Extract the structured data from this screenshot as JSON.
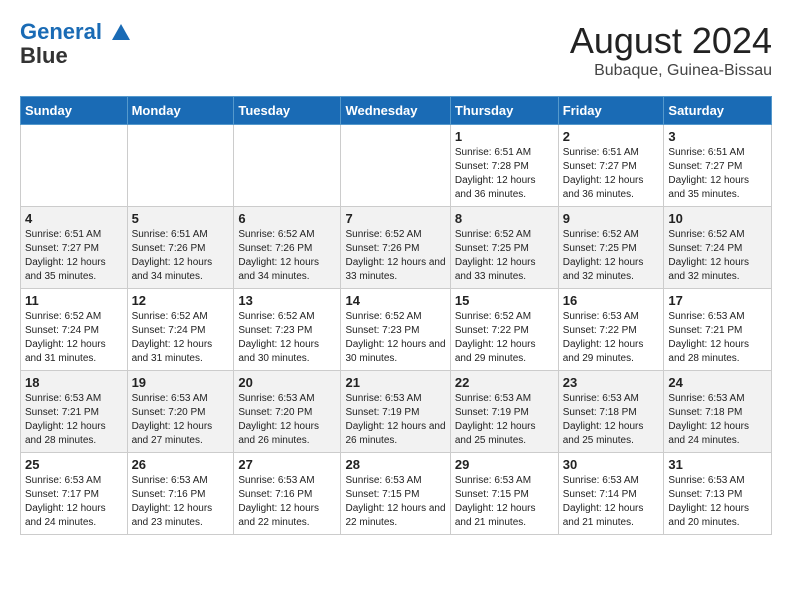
{
  "header": {
    "logo_line1": "General",
    "logo_line2": "Blue",
    "month_year": "August 2024",
    "location": "Bubaque, Guinea-Bissau"
  },
  "weekdays": [
    "Sunday",
    "Monday",
    "Tuesday",
    "Wednesday",
    "Thursday",
    "Friday",
    "Saturday"
  ],
  "weeks": [
    [
      {
        "day": "",
        "sunrise": "",
        "sunset": "",
        "daylight": ""
      },
      {
        "day": "",
        "sunrise": "",
        "sunset": "",
        "daylight": ""
      },
      {
        "day": "",
        "sunrise": "",
        "sunset": "",
        "daylight": ""
      },
      {
        "day": "",
        "sunrise": "",
        "sunset": "",
        "daylight": ""
      },
      {
        "day": "1",
        "sunrise": "Sunrise: 6:51 AM",
        "sunset": "Sunset: 7:28 PM",
        "daylight": "Daylight: 12 hours and 36 minutes."
      },
      {
        "day": "2",
        "sunrise": "Sunrise: 6:51 AM",
        "sunset": "Sunset: 7:27 PM",
        "daylight": "Daylight: 12 hours and 36 minutes."
      },
      {
        "day": "3",
        "sunrise": "Sunrise: 6:51 AM",
        "sunset": "Sunset: 7:27 PM",
        "daylight": "Daylight: 12 hours and 35 minutes."
      }
    ],
    [
      {
        "day": "4",
        "sunrise": "Sunrise: 6:51 AM",
        "sunset": "Sunset: 7:27 PM",
        "daylight": "Daylight: 12 hours and 35 minutes."
      },
      {
        "day": "5",
        "sunrise": "Sunrise: 6:51 AM",
        "sunset": "Sunset: 7:26 PM",
        "daylight": "Daylight: 12 hours and 34 minutes."
      },
      {
        "day": "6",
        "sunrise": "Sunrise: 6:52 AM",
        "sunset": "Sunset: 7:26 PM",
        "daylight": "Daylight: 12 hours and 34 minutes."
      },
      {
        "day": "7",
        "sunrise": "Sunrise: 6:52 AM",
        "sunset": "Sunset: 7:26 PM",
        "daylight": "Daylight: 12 hours and 33 minutes."
      },
      {
        "day": "8",
        "sunrise": "Sunrise: 6:52 AM",
        "sunset": "Sunset: 7:25 PM",
        "daylight": "Daylight: 12 hours and 33 minutes."
      },
      {
        "day": "9",
        "sunrise": "Sunrise: 6:52 AM",
        "sunset": "Sunset: 7:25 PM",
        "daylight": "Daylight: 12 hours and 32 minutes."
      },
      {
        "day": "10",
        "sunrise": "Sunrise: 6:52 AM",
        "sunset": "Sunset: 7:24 PM",
        "daylight": "Daylight: 12 hours and 32 minutes."
      }
    ],
    [
      {
        "day": "11",
        "sunrise": "Sunrise: 6:52 AM",
        "sunset": "Sunset: 7:24 PM",
        "daylight": "Daylight: 12 hours and 31 minutes."
      },
      {
        "day": "12",
        "sunrise": "Sunrise: 6:52 AM",
        "sunset": "Sunset: 7:24 PM",
        "daylight": "Daylight: 12 hours and 31 minutes."
      },
      {
        "day": "13",
        "sunrise": "Sunrise: 6:52 AM",
        "sunset": "Sunset: 7:23 PM",
        "daylight": "Daylight: 12 hours and 30 minutes."
      },
      {
        "day": "14",
        "sunrise": "Sunrise: 6:52 AM",
        "sunset": "Sunset: 7:23 PM",
        "daylight": "Daylight: 12 hours and 30 minutes."
      },
      {
        "day": "15",
        "sunrise": "Sunrise: 6:52 AM",
        "sunset": "Sunset: 7:22 PM",
        "daylight": "Daylight: 12 hours and 29 minutes."
      },
      {
        "day": "16",
        "sunrise": "Sunrise: 6:53 AM",
        "sunset": "Sunset: 7:22 PM",
        "daylight": "Daylight: 12 hours and 29 minutes."
      },
      {
        "day": "17",
        "sunrise": "Sunrise: 6:53 AM",
        "sunset": "Sunset: 7:21 PM",
        "daylight": "Daylight: 12 hours and 28 minutes."
      }
    ],
    [
      {
        "day": "18",
        "sunrise": "Sunrise: 6:53 AM",
        "sunset": "Sunset: 7:21 PM",
        "daylight": "Daylight: 12 hours and 28 minutes."
      },
      {
        "day": "19",
        "sunrise": "Sunrise: 6:53 AM",
        "sunset": "Sunset: 7:20 PM",
        "daylight": "Daylight: 12 hours and 27 minutes."
      },
      {
        "day": "20",
        "sunrise": "Sunrise: 6:53 AM",
        "sunset": "Sunset: 7:20 PM",
        "daylight": "Daylight: 12 hours and 26 minutes."
      },
      {
        "day": "21",
        "sunrise": "Sunrise: 6:53 AM",
        "sunset": "Sunset: 7:19 PM",
        "daylight": "Daylight: 12 hours and 26 minutes."
      },
      {
        "day": "22",
        "sunrise": "Sunrise: 6:53 AM",
        "sunset": "Sunset: 7:19 PM",
        "daylight": "Daylight: 12 hours and 25 minutes."
      },
      {
        "day": "23",
        "sunrise": "Sunrise: 6:53 AM",
        "sunset": "Sunset: 7:18 PM",
        "daylight": "Daylight: 12 hours and 25 minutes."
      },
      {
        "day": "24",
        "sunrise": "Sunrise: 6:53 AM",
        "sunset": "Sunset: 7:18 PM",
        "daylight": "Daylight: 12 hours and 24 minutes."
      }
    ],
    [
      {
        "day": "25",
        "sunrise": "Sunrise: 6:53 AM",
        "sunset": "Sunset: 7:17 PM",
        "daylight": "Daylight: 12 hours and 24 minutes."
      },
      {
        "day": "26",
        "sunrise": "Sunrise: 6:53 AM",
        "sunset": "Sunset: 7:16 PM",
        "daylight": "Daylight: 12 hours and 23 minutes."
      },
      {
        "day": "27",
        "sunrise": "Sunrise: 6:53 AM",
        "sunset": "Sunset: 7:16 PM",
        "daylight": "Daylight: 12 hours and 22 minutes."
      },
      {
        "day": "28",
        "sunrise": "Sunrise: 6:53 AM",
        "sunset": "Sunset: 7:15 PM",
        "daylight": "Daylight: 12 hours and 22 minutes."
      },
      {
        "day": "29",
        "sunrise": "Sunrise: 6:53 AM",
        "sunset": "Sunset: 7:15 PM",
        "daylight": "Daylight: 12 hours and 21 minutes."
      },
      {
        "day": "30",
        "sunrise": "Sunrise: 6:53 AM",
        "sunset": "Sunset: 7:14 PM",
        "daylight": "Daylight: 12 hours and 21 minutes."
      },
      {
        "day": "31",
        "sunrise": "Sunrise: 6:53 AM",
        "sunset": "Sunset: 7:13 PM",
        "daylight": "Daylight: 12 hours and 20 minutes."
      }
    ]
  ]
}
